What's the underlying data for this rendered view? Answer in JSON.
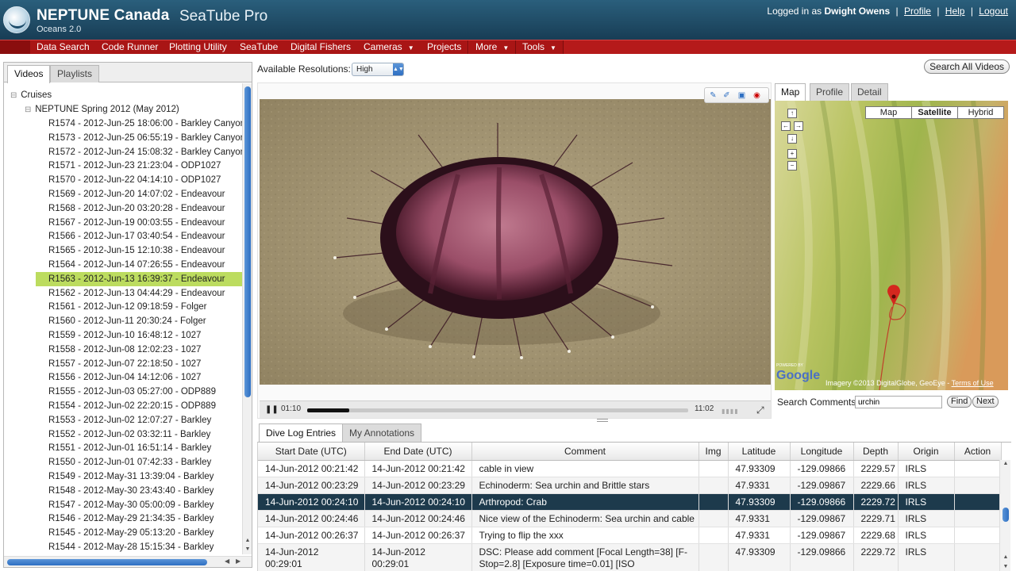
{
  "header": {
    "brand": "NEPTUNE Canada",
    "product": "SeaTube Pro",
    "subtitle": "Oceans 2.0",
    "logged_in_prefix": "Logged in as",
    "user_name": "Dwight Owens",
    "links": [
      "Profile",
      "Help",
      "Logout"
    ]
  },
  "menu": [
    {
      "label": "Data Search"
    },
    {
      "label": "Code Runner"
    },
    {
      "label": "Plotting Utility"
    },
    {
      "label": "SeaTube"
    },
    {
      "label": "Digital Fishers"
    },
    {
      "label": "Cameras",
      "arrow": "▼"
    },
    {
      "label": "Projects"
    },
    {
      "label": "More",
      "arrow": "▼"
    },
    {
      "label": "Tools",
      "arrow": "▼"
    }
  ],
  "left_panel": {
    "tabs": [
      "Videos",
      "Playlists"
    ],
    "tree_root": "Cruises",
    "cruise": "NEPTUNE Spring 2012 (May 2012)",
    "selected_item": "R1563 - 2012-Jun-13 16:39:37 - Endeavour",
    "items": [
      "R1574 - 2012-Jun-25 18:06:00 - Barkley Canyon",
      "R1573 - 2012-Jun-25 06:55:19 - Barkley Canyon",
      "R1572 - 2012-Jun-24 15:08:32 - Barkley Canyon",
      "R1571 - 2012-Jun-23 21:23:04 - ODP1027",
      "R1570 - 2012-Jun-22 04:14:10 - ODP1027",
      "R1569 - 2012-Jun-20 14:07:02 - Endeavour",
      "R1568 - 2012-Jun-20 03:20:28 - Endeavour",
      "R1567 - 2012-Jun-19 00:03:55 - Endeavour",
      "R1566 - 2012-Jun-17 03:40:54 - Endeavour",
      "R1565 - 2012-Jun-15 12:10:38 - Endeavour",
      "R1564 - 2012-Jun-14 07:26:55 - Endeavour",
      "R1563 - 2012-Jun-13 16:39:37 - Endeavour",
      "R1562 - 2012-Jun-13 04:44:29 - Endeavour",
      "R1561 - 2012-Jun-12 09:18:59 - Folger",
      "R1560 - 2012-Jun-11 20:30:24 - Folger",
      "R1559 - 2012-Jun-10 16:48:12 - 1027",
      "R1558 - 2012-Jun-08 12:02:23 - 1027",
      "R1557 - 2012-Jun-07 22:18:50 - 1027",
      "R1556 - 2012-Jun-04 14:12:06 - 1027",
      "R1555 - 2012-Jun-03 05:27:00 - ODP889",
      "R1554 - 2012-Jun-02 22:20:15 - ODP889",
      "R1553 - 2012-Jun-02 12:07:27 - Barkley",
      "R1552 - 2012-Jun-02 03:32:11 - Barkley",
      "R1551 - 2012-Jun-01 16:51:14 - Barkley",
      "R1550 - 2012-Jun-01 07:42:33 - Barkley",
      "R1549 - 2012-May-31 13:39:04 - Barkley",
      "R1548 - 2012-May-30 23:43:40 - Barkley",
      "R1547 - 2012-May-30 05:00:09 - Barkley",
      "R1546 - 2012-May-29 21:34:35 - Barkley",
      "R1545 - 2012-May-29 05:13:20 - Barkley",
      "R1544 - 2012-May-28 15:15:34 - Barkley"
    ]
  },
  "video": {
    "resolution_label": "Available Resolutions:",
    "resolution_value": "High",
    "current_time": "01:10",
    "duration": "11:02",
    "progress_fraction": 0.11,
    "toolbar_icons": [
      "add-annotation-icon",
      "edit-annotation-icon",
      "snapshot-icon",
      "record-icon"
    ]
  },
  "search_all_label": "Search All Videos",
  "map": {
    "tabs": [
      "Map",
      "Profile",
      "Detail"
    ],
    "types": [
      "Map",
      "Satellite",
      "Hybrid"
    ],
    "active_type": "Satellite",
    "powered_by": "POWERED BY",
    "google": "Google",
    "imagery": "Imagery ©2013 DigitalGlobe, GeoEye",
    "terms": "Terms of Use",
    "pan_icons": [
      "pan-up-icon",
      "pan-left-icon",
      "pan-right-icon",
      "pan-down-icon",
      "zoom-in-icon",
      "zoom-out-icon"
    ]
  },
  "search_comments": {
    "label": "Search Comments",
    "value": "urchin",
    "find": "Find",
    "next": "Next"
  },
  "bottom_tabs": [
    "Dive Log Entries",
    "My Annotations"
  ],
  "table": {
    "columns": [
      "Start Date (UTC)",
      "End Date (UTC)",
      "Comment",
      "Img",
      "Latitude",
      "Longitude",
      "Depth",
      "Origin",
      "Action"
    ],
    "rows": [
      {
        "start": "14-Jun-2012 00:21:42",
        "end": "14-Jun-2012 00:21:42",
        "comment": "cable in view",
        "img": "",
        "lat": "47.93309",
        "lon": "-129.09866",
        "depth": "2229.57",
        "origin": "IRLS",
        "action": ""
      },
      {
        "start": "14-Jun-2012 00:23:29",
        "end": "14-Jun-2012 00:23:29",
        "comment": "Echinoderm: Sea urchin and Brittle stars",
        "img": "",
        "lat": "47.9331",
        "lon": "-129.09867",
        "depth": "2229.66",
        "origin": "IRLS",
        "action": ""
      },
      {
        "start": "14-Jun-2012 00:24:10",
        "end": "14-Jun-2012 00:24:10",
        "comment": "Arthropod: Crab",
        "img": "",
        "lat": "47.93309",
        "lon": "-129.09866",
        "depth": "2229.72",
        "origin": "IRLS",
        "action": ""
      },
      {
        "start": "14-Jun-2012 00:24:46",
        "end": "14-Jun-2012 00:24:46",
        "comment": "Nice view of the Echinoderm: Sea urchin and cable",
        "img": "",
        "lat": "47.9331",
        "lon": "-129.09867",
        "depth": "2229.71",
        "origin": "IRLS",
        "action": ""
      },
      {
        "start": "14-Jun-2012 00:26:37",
        "end": "14-Jun-2012 00:26:37",
        "comment": "Trying to flip the xxx",
        "img": "",
        "lat": "47.9331",
        "lon": "-129.09867",
        "depth": "2229.68",
        "origin": "IRLS",
        "action": ""
      },
      {
        "start": "14-Jun-2012 00:29:01",
        "end": "14-Jun-2012 00:29:01",
        "comment": "DSC: Please add comment [Focal Length=38] [F-Stop=2.8] [Exposure time=0.01] [ISO",
        "img": "",
        "lat": "47.93309",
        "lon": "-129.09866",
        "depth": "2229.72",
        "origin": "IRLS",
        "action": ""
      }
    ],
    "selected_row": 2
  }
}
